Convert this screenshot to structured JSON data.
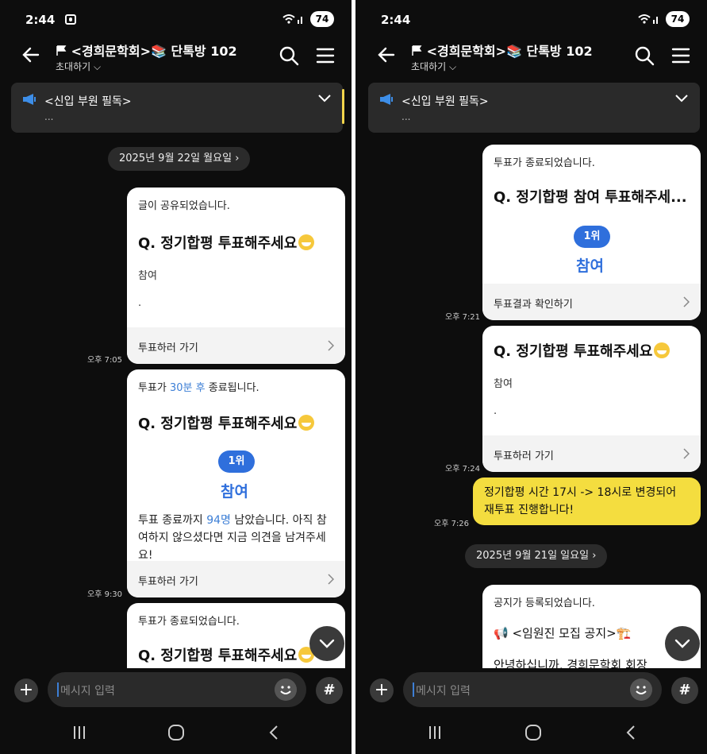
{
  "status": {
    "time": "2:44",
    "battery": "74"
  },
  "chat": {
    "title": "<경희문학회>📚 단톡방 102",
    "invite": "초대하기"
  },
  "notice": {
    "text": "<신입 부원 필독>",
    "preview": "..."
  },
  "input": {
    "placeholder": "메시지 입력"
  },
  "left": {
    "date_chip": "2025년 9월 22일 월요일",
    "card1": {
      "head": "글이 공유되었습니다.",
      "question": "Q. 정기합평 투표해주세요",
      "answer": "참여",
      "dot": ".",
      "footer": "투표하러 가기",
      "time": "오후 7:05"
    },
    "card2": {
      "head_pre": "투표가 ",
      "head_hl": "30분 후",
      "head_post": " 종료됩니다.",
      "question": "Q. 정기합평 투표해주세요",
      "rank": "1위",
      "rank_name": "참여",
      "body_pre": "투표 종료까지 ",
      "body_hl": "94명",
      "body_post": " 남았습니다. 아직 참여하지 않으셨다면 지금 의견을 남겨주세요!",
      "footer": "투표하러 가기",
      "time": "오후 9:30"
    },
    "card3": {
      "head": "투표가 종료되었습니다.",
      "question": "Q. 정기합평 투표해주세요"
    }
  },
  "right": {
    "card1": {
      "head": "투표가 종료되었습니다.",
      "question": "Q. 정기합평 참여 투표해주세...",
      "rank": "1위",
      "rank_name": "참여",
      "footer": "투표결과 확인하기",
      "time": "오후 7:21"
    },
    "card2": {
      "question": "Q. 정기합평 투표해주세요",
      "answer": "참여",
      "dot": ".",
      "footer": "투표하러 가기",
      "time": "오후 7:24"
    },
    "message": {
      "text": "정기합평 시간 17시 -> 18시로 변경되어 재투표 진행합니다!",
      "time": "오후 7:26"
    },
    "date_chip": "2025년 9월 21일 일요일",
    "card3": {
      "head": "공지가 등록되었습니다.",
      "notice_line": "📢 <임원진 모집 공지>🏗️",
      "cut_text": "안녕하십니까, 경희문학회 회장"
    }
  },
  "colors": {
    "accent_blue": "#2f6fdc",
    "link_blue": "#3d7fd6",
    "yellow_bubble": "#f4dd3f",
    "background": "#0d0d0d"
  }
}
